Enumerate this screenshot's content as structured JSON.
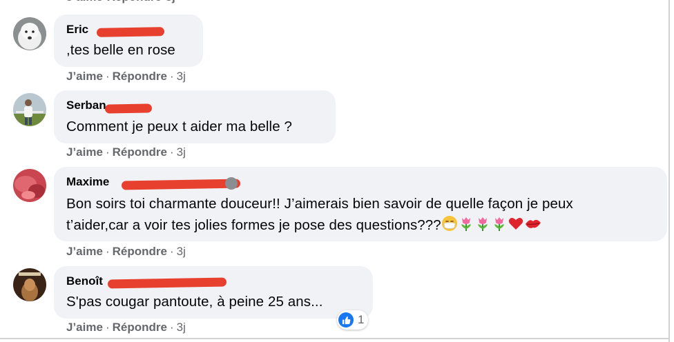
{
  "actions": {
    "like": "J’aime",
    "reply": "Répondre",
    "sep": "·",
    "time": "3j"
  },
  "comments": [
    {
      "author": "Eric",
      "text_lines": [
        ",tes belle en rose"
      ]
    },
    {
      "author": "Serban",
      "text_lines": [
        "Comment je peux t aider ma belle ?"
      ]
    },
    {
      "author": "Maxime",
      "text_lines": [
        "Bon soirs toi charmante douceur!! J’aimerais bien savoir de quelle façon je peux",
        "t’aider,car a voir tes jolies formes je pose des questions???"
      ],
      "emojis": [
        "face-with-medical-mask",
        "tulip",
        "tulip",
        "tulip",
        "red-heart",
        "kiss-mark"
      ]
    },
    {
      "author": "Benoît",
      "text_lines": [
        "S'pas cougar pantoute, à peine 25 ans..."
      ],
      "reactions": {
        "type": "like",
        "count": "1"
      }
    }
  ],
  "colors": {
    "bubble": "#f0f2f5",
    "muted_text": "#65676b",
    "redaction": "#e8402e",
    "like_blue": "#1877f2"
  }
}
